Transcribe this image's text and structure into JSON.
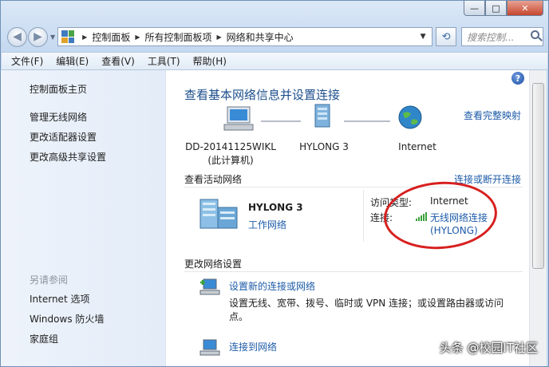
{
  "window": {
    "buttons": {
      "minimize": "—",
      "maximize": "□",
      "close": "✕"
    }
  },
  "nav": {
    "back": "◀",
    "forward": "▶",
    "breadcrumb": [
      "控制面板",
      "所有控制面板项",
      "网络和共享中心"
    ],
    "search_placeholder": "搜索控制..."
  },
  "menu": [
    "文件(F)",
    "编辑(E)",
    "查看(V)",
    "工具(T)",
    "帮助(H)"
  ],
  "sidebar": {
    "home": "控制面板主页",
    "links": [
      "管理无线网络",
      "更改适配器设置",
      "更改高级共享设置"
    ],
    "see_also_title": "另请参阅",
    "see_also": [
      "Internet 选项",
      "Windows 防火墙",
      "家庭组"
    ]
  },
  "main": {
    "help": "?",
    "title": "查看基本网络信息并设置连接",
    "full_map": "查看完整映射",
    "map": {
      "computer": {
        "name": "DD-20141125WIKL",
        "sub": "(此计算机)"
      },
      "network": {
        "name": "HYLONG  3"
      },
      "internet": {
        "name": "Internet"
      }
    },
    "active": {
      "heading": "查看活动网络",
      "connect_link": "连接或断开连接",
      "name": "HYLONG  3",
      "type": "工作网络",
      "access_label": "访问类型:",
      "access_value": "Internet",
      "conn_label": "连接:",
      "conn_value": "无线网络连接",
      "conn_value2": "(HYLONG)"
    },
    "change": {
      "heading": "更改网络设置",
      "tasks": [
        {
          "title": "设置新的连接或网络",
          "desc": "设置无线、宽带、拨号、临时或 VPN 连接；或设置路由器或访问点。"
        },
        {
          "title": "连接到网络",
          "desc": ""
        }
      ]
    }
  },
  "watermark": "头条 @校园IT社区",
  "colors": {
    "link": "#1d5ba8",
    "title": "#1d4f8c",
    "annotation": "#d7201f"
  }
}
